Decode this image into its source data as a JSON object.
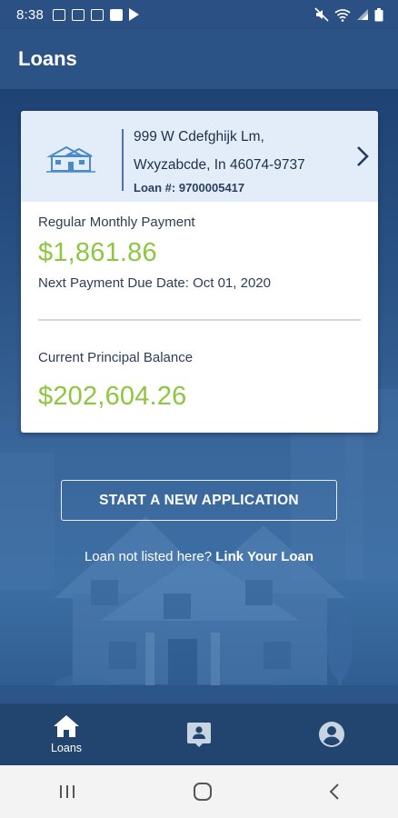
{
  "status_bar": {
    "time": "8:38"
  },
  "app_bar": {
    "title": "Loans"
  },
  "loan_card": {
    "address_line1": "999 W Cdefghijk Lm,",
    "address_line2": "Wxyzabcde, In 46074-9737",
    "loan_number": "Loan #: 9700005417",
    "monthly_payment_label": "Regular Monthly Payment",
    "monthly_payment_value": "$1,861.86",
    "next_due": "Next Payment Due Date: Oct 01, 2020",
    "principal_label": "Current Principal Balance",
    "principal_value": "$202,604.26"
  },
  "actions": {
    "start_application": "START A NEW APPLICATION",
    "link_prompt": "Loan not listed here?",
    "link_text": "Link Your Loan"
  },
  "bottom_nav": {
    "items": [
      {
        "label": "Loans",
        "icon": "home-icon"
      },
      {
        "label": "",
        "icon": "contact-card-icon"
      },
      {
        "label": "",
        "icon": "account-circle-icon"
      }
    ]
  },
  "colors": {
    "accent_green": "#8dc63f",
    "brand_blue": "#2c5386"
  }
}
